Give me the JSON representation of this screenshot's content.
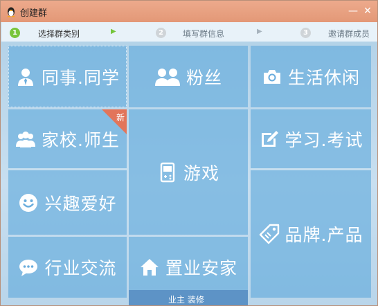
{
  "window": {
    "title": "创建群",
    "minimize_glyph": "—",
    "close_glyph": "✕"
  },
  "steps": [
    {
      "number": "1",
      "label": "选择群类别",
      "state": "active"
    },
    {
      "number": "2",
      "label": "填写群信息",
      "state": "inactive"
    },
    {
      "number": "3",
      "label": "邀请群成员",
      "state": "inactive"
    }
  ],
  "categories": {
    "colleagues": {
      "label": "同事.同学",
      "icon": "person-tie-icon"
    },
    "fans": {
      "label": "粉丝",
      "icon": "two-people-icon"
    },
    "lifestyle": {
      "label": "生活休闲",
      "icon": "camera-icon"
    },
    "school": {
      "label": "家校.师生",
      "icon": "group-icon",
      "badge": "新"
    },
    "games": {
      "label": "游戏",
      "icon": "gamepad-icon"
    },
    "study": {
      "label": "学习.考试",
      "icon": "edit-icon"
    },
    "hobbies": {
      "label": "兴趣爱好",
      "icon": "smiley-icon"
    },
    "brands": {
      "label": "品牌.产品",
      "icon": "tag-icon"
    },
    "industry": {
      "label": "行业交流",
      "icon": "chat-bubble-icon"
    },
    "realestate": {
      "label": "置业安家",
      "icon": "house-icon"
    }
  },
  "realestate_strip": "业主 装修",
  "colors": {
    "titlebar": "#e39877",
    "tile": "#60aadc",
    "badge": "#e2755a",
    "step_active": "#78c53b"
  }
}
